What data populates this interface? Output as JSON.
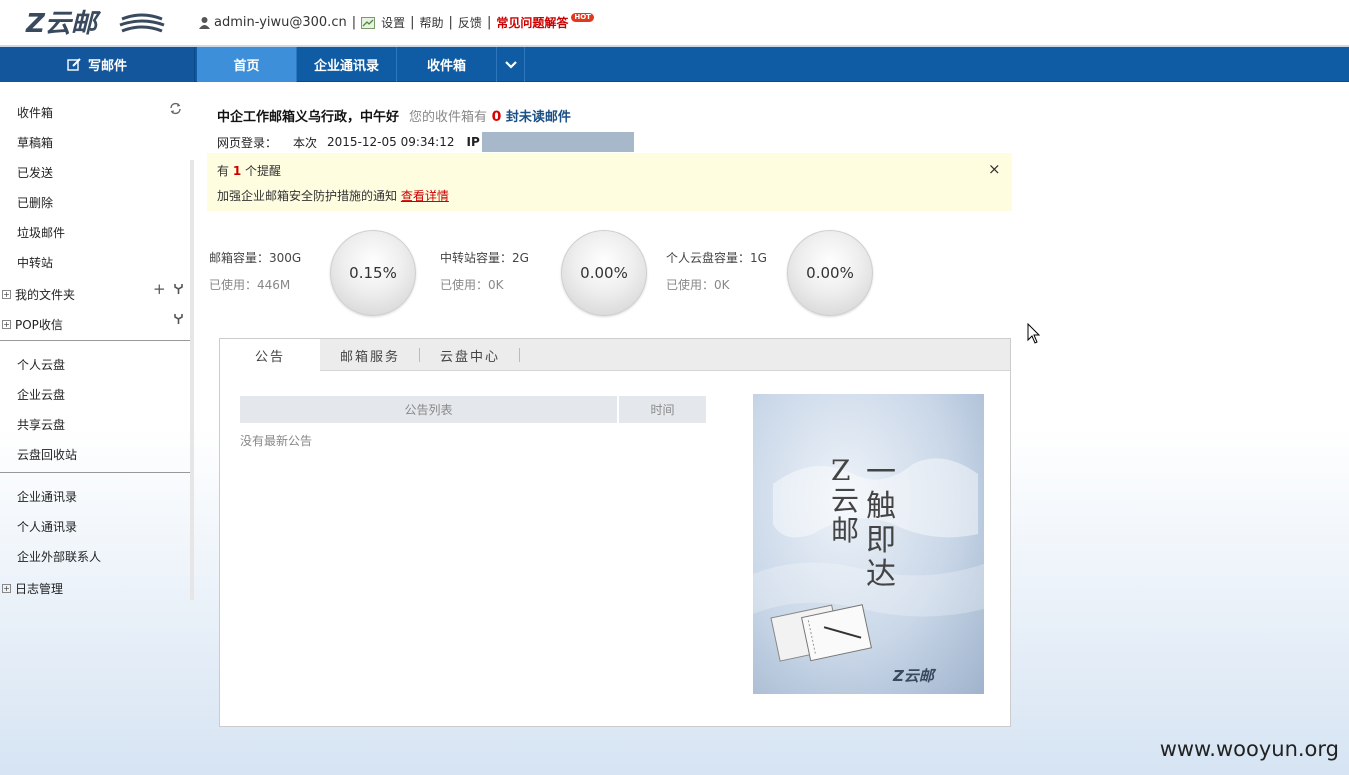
{
  "header": {
    "logo_text": "Z云邮",
    "user": "admin-yiwu@300.cn",
    "links": [
      "设置",
      "帮助",
      "反馈"
    ],
    "faq": "常见问题解答",
    "hot_badge": "HOT"
  },
  "nav": {
    "compose_label": "写邮件",
    "tabs": [
      {
        "label": "首页",
        "active": true
      },
      {
        "label": "企业通讯录",
        "active": false
      },
      {
        "label": "收件箱",
        "active": false
      }
    ]
  },
  "sidebar": {
    "mail": [
      "收件箱",
      "草稿箱",
      "已发送",
      "已删除",
      "垃圾邮件",
      "中转站"
    ],
    "folders": [
      "我的文件夹",
      "POP收信"
    ],
    "cloud": [
      "个人云盘",
      "企业云盘",
      "共享云盘",
      "云盘回收站"
    ],
    "contacts": [
      "企业通讯录",
      "个人通讯录",
      "企业外部联系人"
    ],
    "logs": "日志管理"
  },
  "main": {
    "greeting": "中企工作邮箱义乌行政，中午好",
    "inbox_prefix": "您的收件箱有",
    "unread_count": "0",
    "inbox_suffix": "封未读邮件",
    "login_label": "网页登录：",
    "login_this": "本次",
    "login_time": "2015-12-05 09:34:12",
    "ip_label": "IP"
  },
  "reminder": {
    "prefix": "有",
    "count": "1",
    "suffix": "个提醒",
    "message": "加强企业邮箱安全防护措施的通知",
    "link": "查看详情",
    "close": "×"
  },
  "quotas": [
    {
      "label": "邮箱容量：300G",
      "used": "已使用：446M",
      "percent": "0.15%"
    },
    {
      "label": "中转站容量：2G",
      "used": "已使用：0K",
      "percent": "0.00%"
    },
    {
      "label": "个人云盘容量：1G",
      "used": "已使用：0K",
      "percent": "0.00%"
    }
  ],
  "panel": {
    "tabs": [
      "公告",
      "邮箱服务",
      "云盘中心"
    ],
    "col_list": "公告列表",
    "col_time": "时间",
    "empty": "没有最新公告",
    "promo_left": "Z云邮",
    "promo_right": "一触即达",
    "promo_logo": "Z云邮"
  },
  "watermark": "www.wooyun.org",
  "colors": {
    "nav": "#0f5ca4",
    "nav_active": "#3c8fd8",
    "reminder_bg": "#fefde0",
    "unread": "#dd0000"
  }
}
